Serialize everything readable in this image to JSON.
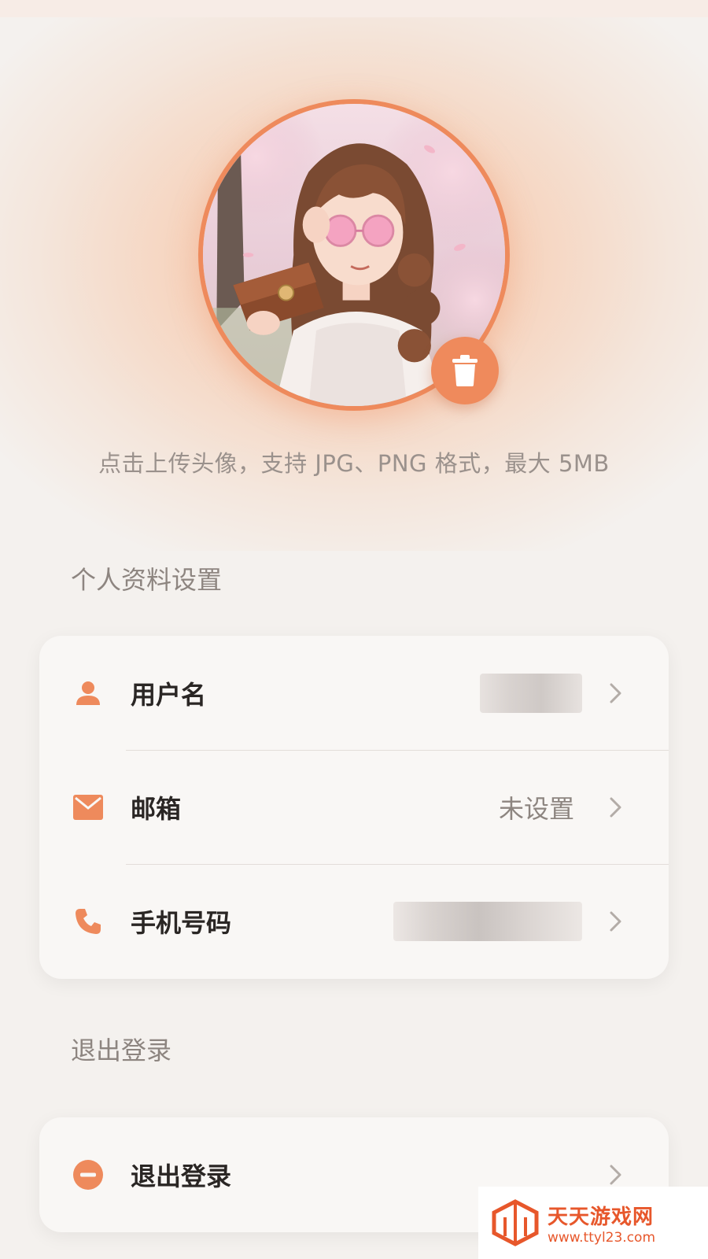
{
  "avatar": {
    "delete_icon": "trash-icon",
    "accent_color": "#ee8a5c"
  },
  "upload_hint": "点击上传头像，支持 JPG、PNG 格式，最大 5MB",
  "profile_section": {
    "title": "个人资料设置",
    "rows": [
      {
        "icon": "person-icon",
        "label": "用户名",
        "value": ""
      },
      {
        "icon": "mail-icon",
        "label": "邮箱",
        "value": "未设置"
      },
      {
        "icon": "phone-icon",
        "label": "手机号码",
        "value": ""
      }
    ]
  },
  "logout_section": {
    "title": "退出登录",
    "rows": [
      {
        "icon": "minus-circle-icon",
        "label": "退出登录"
      }
    ]
  },
  "watermark": {
    "name": "天天游戏网",
    "url": "www.ttyl23.com"
  }
}
